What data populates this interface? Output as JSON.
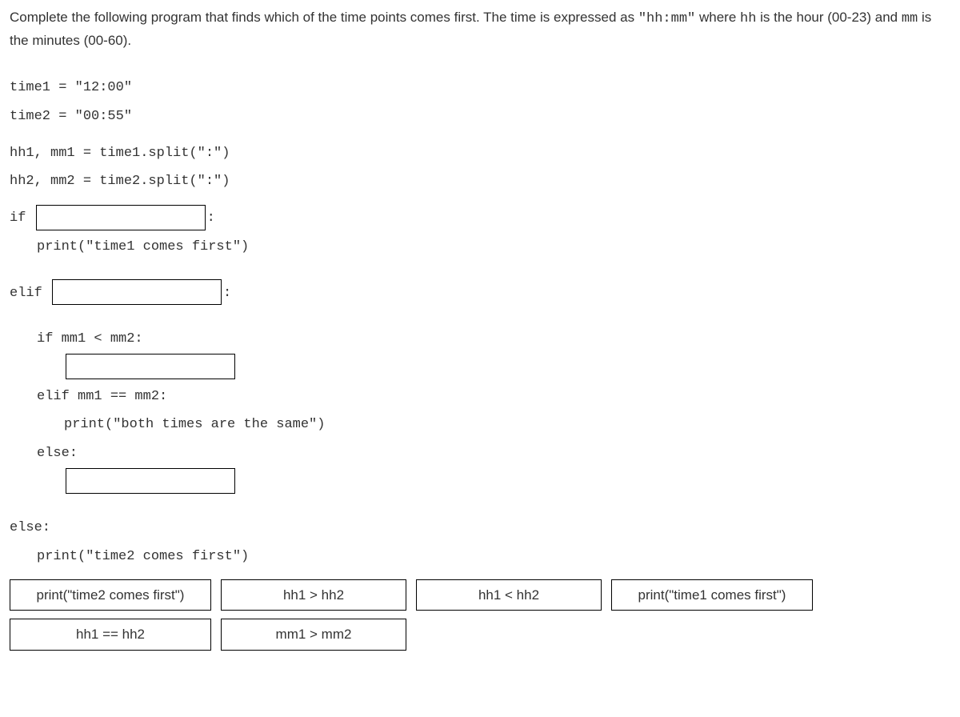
{
  "question": {
    "pre": "Complete the following program that finds which of the time points comes first. The time is expressed as ",
    "format_code": "\"hh:mm\"",
    "mid": " where ",
    "hh_code": "hh",
    "mid2": " is the hour (00-23) and ",
    "mm_code": "mm",
    "post": " is the minutes (00-60)."
  },
  "code": {
    "l1": "time1 = \"12:00\"",
    "l2": "time2 = \"00:55\"",
    "l3": "hh1, mm1 = time1.split(\":\")",
    "l4": "hh2, mm2 = time2.split(\":\")",
    "if_kw": "if ",
    "colon": ":",
    "print_t1": "print(\"time1 comes first\")",
    "elif_kw": "elif ",
    "if_mm": "if mm1 < mm2:",
    "elif_mm": "elif mm1 == mm2:",
    "print_same": "print(\"both times are the same\")",
    "else_kw": "else:",
    "print_t2": "print(\"time2 comes first\")"
  },
  "answers": {
    "a1": "print(\"time2 comes first\")",
    "a2": "hh1 > hh2",
    "a3": "hh1 < hh2",
    "a4": "print(\"time1 comes first\")",
    "a5": "hh1 == hh2",
    "a6": "mm1 > mm2"
  }
}
